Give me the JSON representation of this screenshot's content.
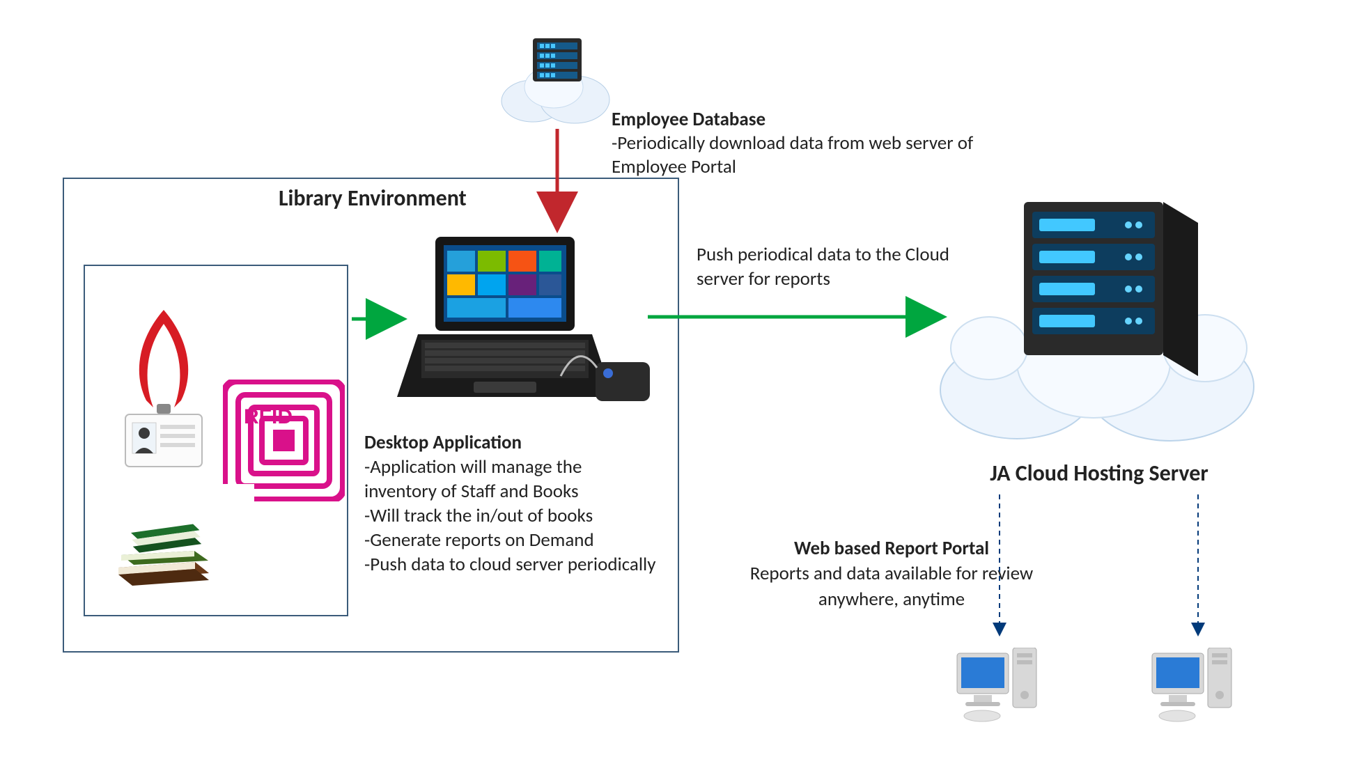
{
  "library": {
    "title": "Library Environment"
  },
  "rfid": {
    "label": "RFID"
  },
  "employee_database": {
    "title": "Employee Database",
    "line1": "-Periodically download data from web server of Employee Portal"
  },
  "desktop_app": {
    "title": "Desktop Application",
    "line1": "-Application will manage the inventory of Staff and Books",
    "line2": "-Will track the in/out of books",
    "line3": "-Generate reports on Demand",
    "line4": "-Push data to cloud server periodically"
  },
  "push_text": {
    "line1": "Push periodical data to the Cloud server for reports"
  },
  "ja_cloud": {
    "title": "JA Cloud Hosting Server"
  },
  "report_portal": {
    "title": "Web based Report Portal",
    "line1": "Reports and data available for review anywhere, anytime"
  },
  "icons": {
    "cloud_server_small": "cloud-server-icon",
    "cloud_server_big": "cloud-server-icon",
    "laptop": "laptop-icon",
    "rfid_reader": "rfid-reader-icon",
    "id_card": "id-card-icon",
    "books": "books-icon",
    "rfid_tag": "rfid-tag-icon",
    "desktop_pc": "desktop-pc-icon"
  },
  "arrows": {
    "color_green": "#00a63f",
    "color_red": "#c1272d",
    "color_blue": "#003a7a"
  }
}
